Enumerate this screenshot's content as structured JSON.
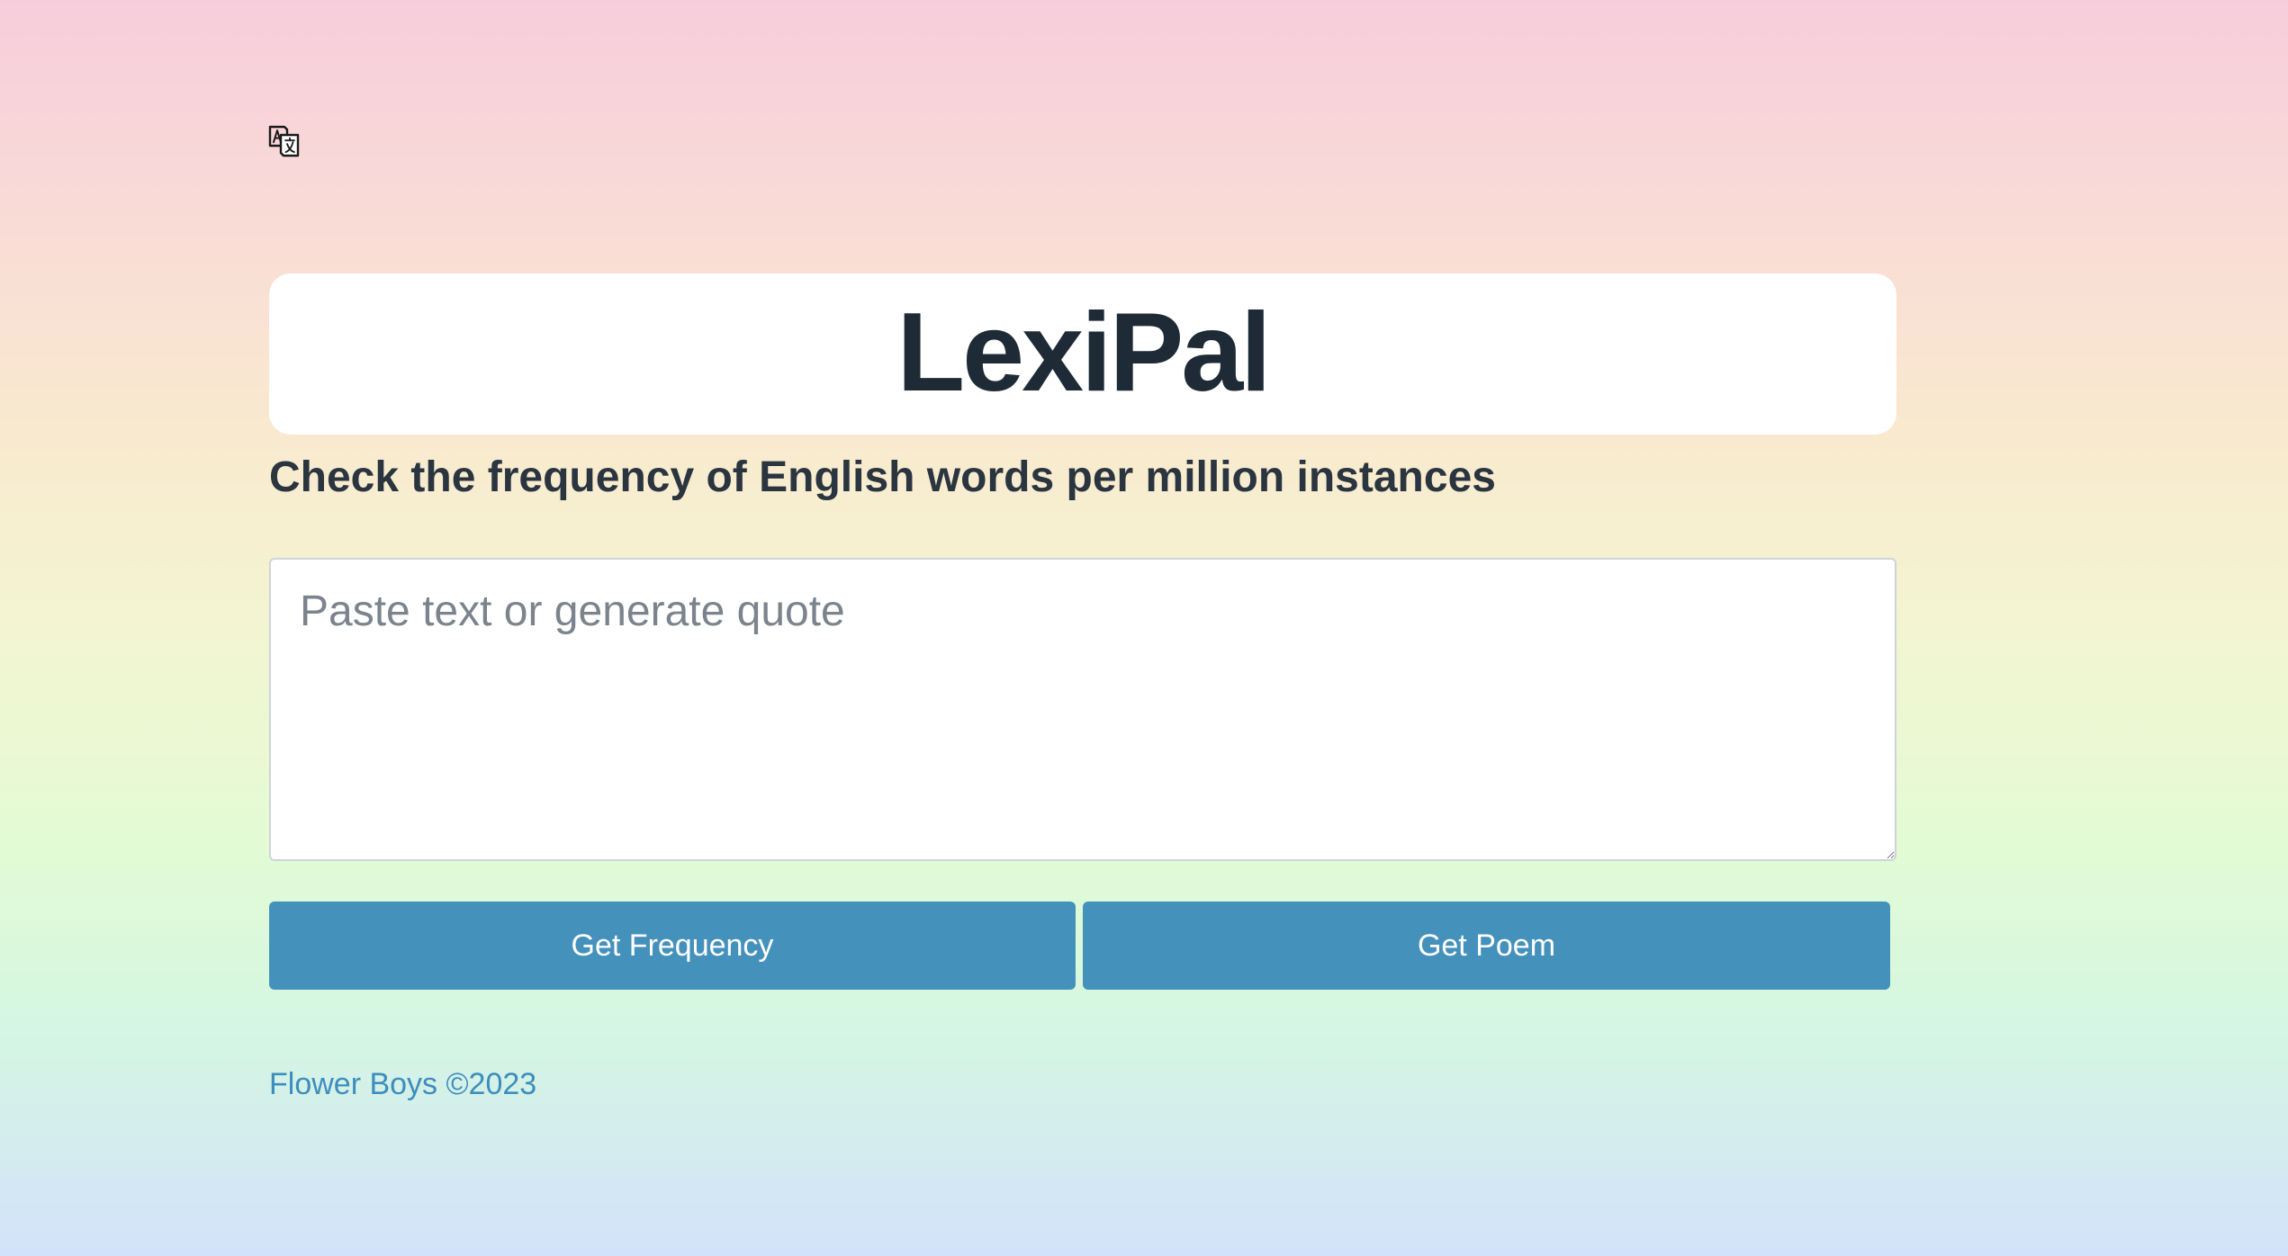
{
  "app": {
    "title": "LexiPal",
    "subtitle": "Check the frequency of English words per million instances",
    "icon": "translate-icon"
  },
  "input": {
    "value": "",
    "placeholder": "Paste text or generate quote"
  },
  "actions": {
    "frequency_label": "Get Frequency",
    "poem_label": "Get Poem"
  },
  "footer": {
    "text": "Flower Boys ©2023"
  },
  "colors": {
    "accent": "#4492bc",
    "title_text": "#1e2a36",
    "footer_text": "#3d8ebd",
    "card_bg": "#ffffff"
  }
}
